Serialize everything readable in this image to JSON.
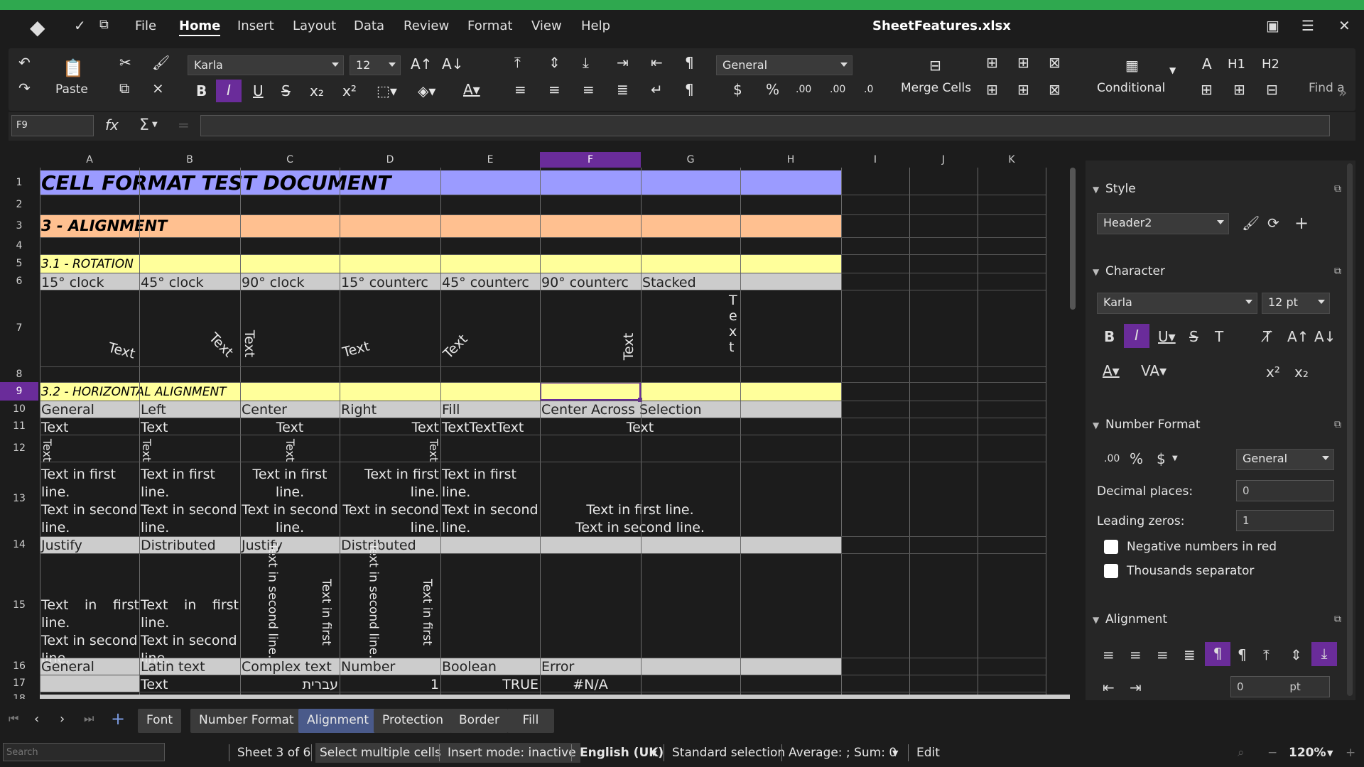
{
  "menubar": {
    "items": [
      "File",
      "Home",
      "Insert",
      "Layout",
      "Data",
      "Review",
      "Format",
      "View",
      "Help"
    ],
    "active": "Home",
    "doc_title": "SheetFeatures.xlsx"
  },
  "ribbon": {
    "paste_label": "Paste",
    "font_name": "Karla",
    "font_size": "12",
    "number_format": "General",
    "merge_label": "Merge Cells",
    "conditional_label": "Conditional",
    "h1": "H1",
    "h2": "H2",
    "a_label": "A",
    "find_label": "Find a",
    "bold": "B",
    "italic": "I",
    "underline": "U",
    "strike": "S",
    "currency": "$",
    "percent": "%",
    "dec1": ".00",
    "dec2": ".00",
    "dec3": ".0"
  },
  "formula": {
    "namebox": "F9",
    "fx": "fx",
    "sigma": "Σ",
    "equals": "="
  },
  "columns": [
    "A",
    "B",
    "C",
    "D",
    "E",
    "F",
    "G",
    "H",
    "I",
    "J",
    "K"
  ],
  "rows": [
    "1",
    "2",
    "3",
    "4",
    "5",
    "6",
    "7",
    "8",
    "9",
    "10",
    "11",
    "12",
    "13",
    "14",
    "15",
    "16",
    "17",
    "18"
  ],
  "cells": {
    "r1": "CELL FORMAT TEST DOCUMENT",
    "r3": "3 - ALIGNMENT",
    "r5": "3.1 - ROTATION",
    "r6": [
      "15° clock",
      "45° clock",
      "90° clock",
      "15° counterc",
      "45° counterc",
      "90° counterc",
      "Stacked"
    ],
    "r7": [
      "Text",
      "Text",
      "Text",
      "Text",
      "Text",
      "Text",
      "Text"
    ],
    "r9": "3.2 - HORIZONTAL ALIGNMENT",
    "r10": [
      "General",
      "Left",
      "Center",
      "Right",
      "Fill",
      "Center Across Selection"
    ],
    "r11": [
      "Text",
      "Text",
      "Text",
      "Text",
      "TextTextText",
      "Text"
    ],
    "r12": [
      "Text",
      "Text",
      "Text",
      "Text"
    ],
    "r13_line1": "Text in first line.",
    "r13_line2": "Text in second line.",
    "r13_a": [
      "Text in first",
      "line.",
      "Text in second",
      "line."
    ],
    "r14": [
      "Justify",
      "Distributed",
      "Justify",
      "Distributed"
    ],
    "r15_a": [
      "Text in first",
      "line.",
      "Text in second",
      "line."
    ],
    "r15_vert1": "Text in second line.",
    "r15_vert2": "Text in first",
    "r16": [
      "General",
      "Latin text",
      "Complex text",
      "Number",
      "Boolean",
      "Error"
    ],
    "r17": [
      "Text",
      "עברית",
      "1",
      "TRUE",
      "#N/A"
    ]
  },
  "sidebar": {
    "style_head": "Style",
    "style_value": "Header2",
    "char_head": "Character",
    "char_font": "Karla",
    "char_size": "12 pt",
    "numfmt_head": "Number Format",
    "numfmt_value": "General",
    "decimal_label": "Decimal places:",
    "decimal_value": "0",
    "leading_label": "Leading zeros:",
    "leading_value": "1",
    "neg_red": "Negative numbers in red",
    "thousands": "Thousands separator",
    "align_head": "Alignment",
    "indent_value": "0",
    "indent_unit": "pt",
    "dec_icon": ".00",
    "pct_icon": "%",
    "cur_icon": "$"
  },
  "tabs": [
    "Font",
    "Number Format",
    "Alignment",
    "Protection",
    "Border",
    "Fill"
  ],
  "active_tab": "Alignment",
  "status": {
    "search_placeholder": "Search",
    "sheet": "Sheet 3 of 6",
    "select_mode": "Select multiple cells",
    "insert_mode": "Insert mode: inactive",
    "language": "English (UK)",
    "selection": "Standard selection",
    "summary": "Average: ; Sum: 0",
    "edit": "Edit",
    "zoom": "120%"
  },
  "colors": {
    "title_band": "#9b9bff",
    "section_band": "#ffc090",
    "subsection_band": "#ffff9b",
    "header_band": "#cccccc",
    "accent": "#6a2c9a",
    "topbar": "#2fa84f"
  }
}
